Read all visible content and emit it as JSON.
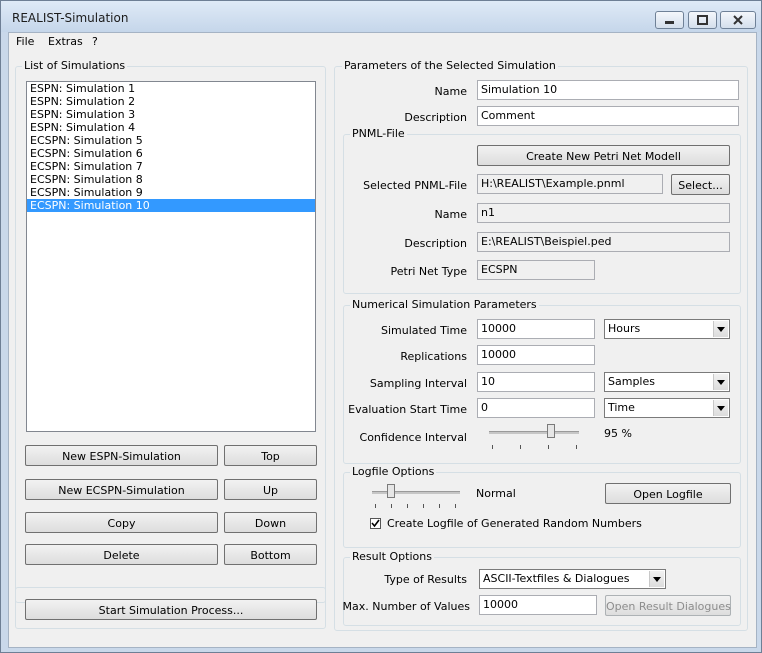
{
  "window": {
    "title": "REALIST-Simulation"
  },
  "menu": [
    "File",
    "Extras",
    "?"
  ],
  "list_group": {
    "title": "List of Simulations",
    "items": [
      "ESPN: Simulation 1",
      "ESPN: Simulation 2",
      "ESPN: Simulation 3",
      "ESPN: Simulation 4",
      "ECSPN: Simulation 5",
      "ECSPN: Simulation 6",
      "ECSPN: Simulation 7",
      "ECSPN: Simulation 8",
      "ECSPN: Simulation 9",
      "ECSPN: Simulation 10"
    ],
    "selected_index": 9,
    "buttons": {
      "new_espn": "New ESPN-Simulation",
      "new_ecspn": "New ECSPN-Simulation",
      "copy": "Copy",
      "delete": "Delete",
      "top": "Top",
      "up": "Up",
      "down": "Down",
      "bottom": "Bottom"
    }
  },
  "start_button": "Start Simulation Process...",
  "params": {
    "title": "Parameters of the Selected Simulation",
    "name_label": "Name",
    "name_value": "Simulation 10",
    "desc_label": "Description",
    "desc_value": "Comment",
    "pnml": {
      "title": "PNML-File",
      "create_button": "Create New Petri Net Modell",
      "selected_label": "Selected PNML-File",
      "selected_value": "H:\\REALIST\\Example.pnml",
      "select_button": "Select...",
      "name_label": "Name",
      "name_value": "n1",
      "desc_label": "Description",
      "desc_value": "E:\\REALIST\\Beispiel.ped",
      "type_label": "Petri Net Type",
      "type_value": "ECSPN"
    },
    "numerical": {
      "title": "Numerical Simulation Parameters",
      "sim_time_label": "Simulated Time",
      "sim_time_value": "10000",
      "sim_time_unit": "Hours",
      "replications_label": "Replications",
      "replications_value": "10000",
      "sampling_label": "Sampling Interval",
      "sampling_value": "10",
      "sampling_unit": "Samples",
      "eval_label": "Evaluation Start Time",
      "eval_value": "0",
      "eval_unit": "Time",
      "confidence_label": "Confidence Interval",
      "confidence_value": "95 %"
    },
    "logfile": {
      "title": "Logfile Options",
      "level": "Normal",
      "open_button": "Open Logfile",
      "checkbox_label": "Create Logfile of Generated Random Numbers",
      "checkbox_checked": true
    },
    "result": {
      "title": "Result Options",
      "type_label": "Type of Results",
      "type_value": "ASCII-Textfiles & Dialogues",
      "max_label": "Max. Number of Values",
      "max_value": "10000",
      "open_button": "Open Result Dialogues"
    }
  },
  "colors": {
    "selection": "#3399ff",
    "titlebar": "#c5d6ea"
  }
}
